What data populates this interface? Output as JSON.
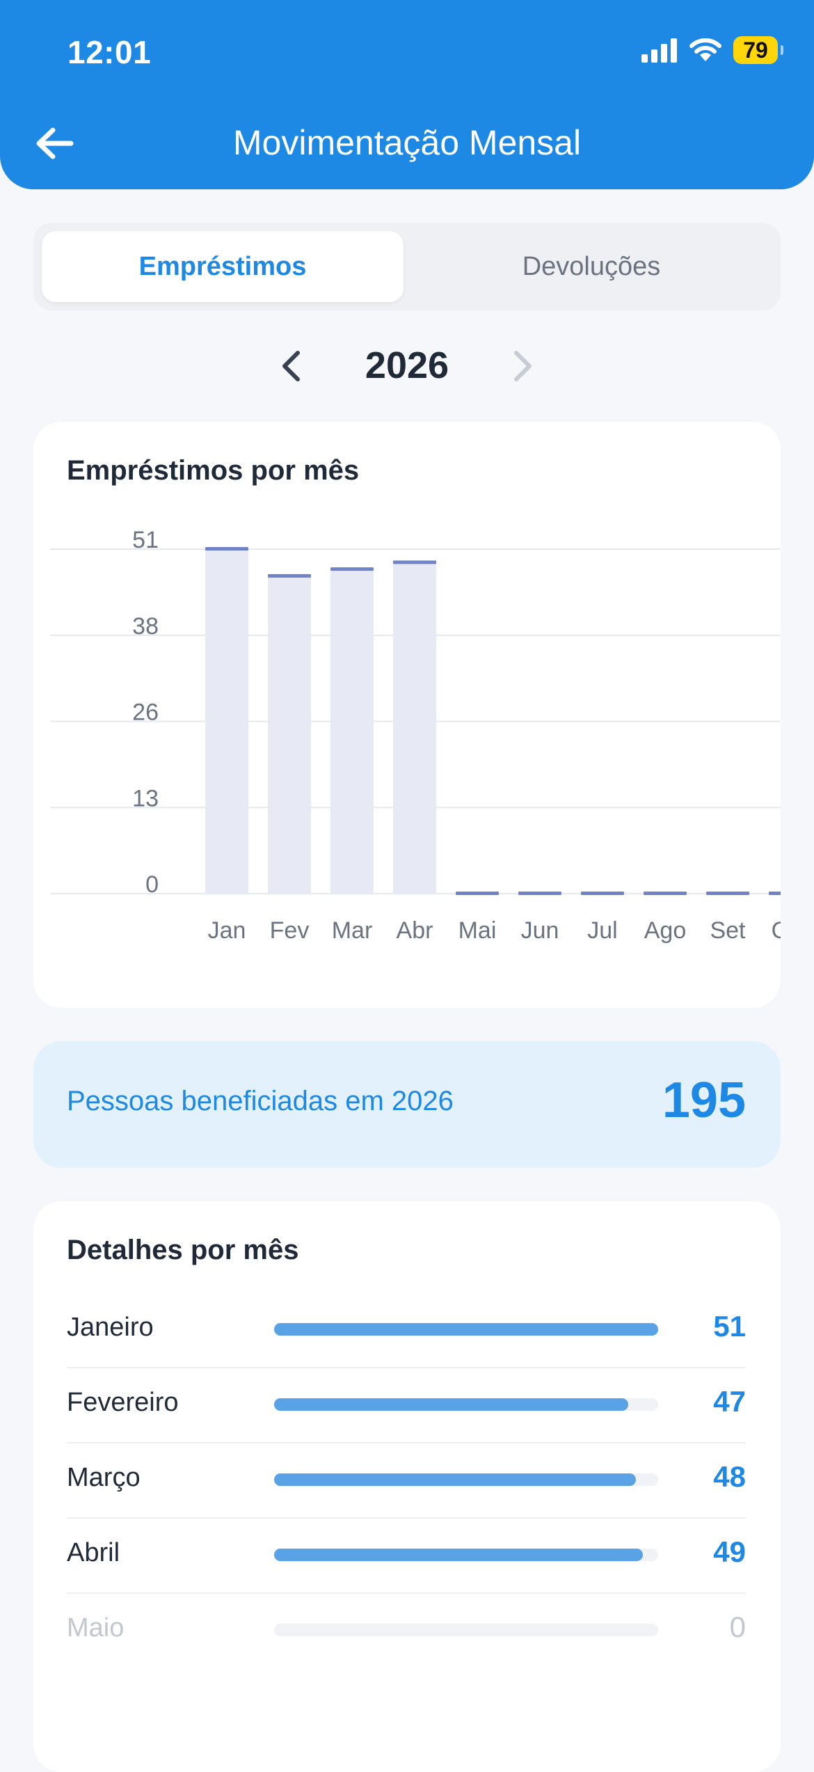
{
  "status_bar": {
    "time": "12:01",
    "battery": "79"
  },
  "header": {
    "title": "Movimentação Mensal"
  },
  "tabs": [
    {
      "label": "Empréstimos",
      "active": true
    },
    {
      "label": "Devoluções",
      "active": false
    }
  ],
  "year_selector": {
    "year": "2026"
  },
  "chart_card": {
    "title": "Empréstimos por mês"
  },
  "chart_data": {
    "type": "bar",
    "title": "Empréstimos por mês",
    "categories": [
      "Jan",
      "Fev",
      "Mar",
      "Abr",
      "Mai",
      "Jun",
      "Jul",
      "Ago",
      "Set",
      "Out"
    ],
    "values": [
      51,
      47,
      48,
      49,
      0,
      0,
      0,
      0,
      0,
      0
    ],
    "y_ticks": [
      "51",
      "38",
      "26",
      "13",
      "0"
    ],
    "ylim": [
      0,
      51
    ],
    "grid": true,
    "colors": {
      "bar_fill": "#E7EAF5",
      "bar_cap": "#7083C6"
    }
  },
  "summary": {
    "label": "Pessoas beneficiadas em 2026",
    "value": "195"
  },
  "details": {
    "title": "Detalhes por mês",
    "rows": [
      {
        "month": "Janeiro",
        "value": "51",
        "fraction": 1.0
      },
      {
        "month": "Fevereiro",
        "value": "47",
        "fraction": 0.9216
      },
      {
        "month": "Março",
        "value": "48",
        "fraction": 0.9412
      },
      {
        "month": "Abril",
        "value": "49",
        "fraction": 0.9608
      },
      {
        "month": "Maio",
        "value": "0",
        "fraction": 0
      }
    ]
  },
  "colors": {
    "primary": "#1E88E5",
    "background": "#F5F7FA",
    "summary_bg": "#E3F1FC",
    "detail_fill": "#5AA2E6"
  }
}
